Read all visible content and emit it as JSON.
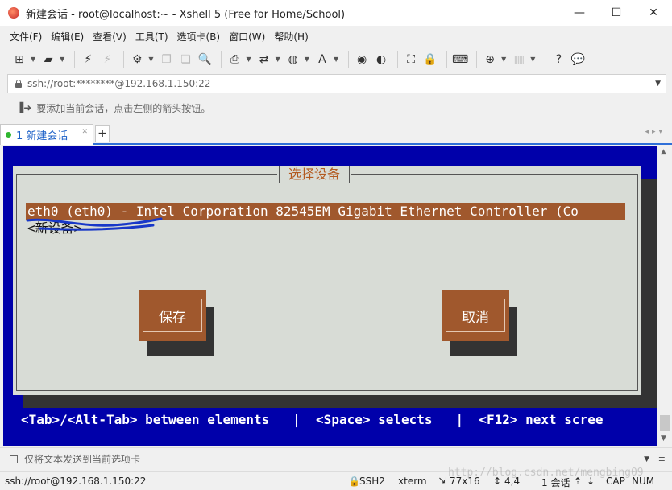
{
  "window": {
    "title": "新建会话 - root@localhost:~ - Xshell 5 (Free for Home/School)",
    "minimize": "—",
    "maximize": "☐",
    "close": "✕"
  },
  "menu": [
    "文件(F)",
    "编辑(E)",
    "查看(V)",
    "工具(T)",
    "选项卡(B)",
    "窗口(W)",
    "帮助(H)"
  ],
  "address": {
    "value": "ssh://root:********@192.168.1.150:22"
  },
  "hint": {
    "text": "要添加当前会话，点击左侧的箭头按钮。"
  },
  "tabs": [
    {
      "label": "1 新建会话"
    }
  ],
  "terminal": {
    "dialog_title": "选择设备",
    "selected_device": "eth0 (eth0) - Intel Corporation 82545EM Gigabit Ethernet Controller (Co",
    "new_device": "<新设备>",
    "save_button": "保存",
    "cancel_button": "取消",
    "status_line": "<Tab>/<Alt-Tab> between elements   |  <Space> selects   |  <F12> next scree"
  },
  "compose": {
    "placeholder": "仅将文本发送到当前选项卡"
  },
  "statusbar": {
    "connection": "ssh://root@192.168.1.150:22",
    "protocol": "SSH2",
    "terminal_type": "xterm",
    "size": "77x16",
    "cursor": "4,4",
    "sessions": "1 会话",
    "caps": "CAP",
    "num": "NUM"
  },
  "watermark": "http://blog.csdn.net/mengbing09",
  "colors": {
    "terminal_bg": "#0000aa",
    "dialog_bg": "#d8dcd6",
    "accent": "#a0582d",
    "tab_accent": "#2f6fd8"
  }
}
